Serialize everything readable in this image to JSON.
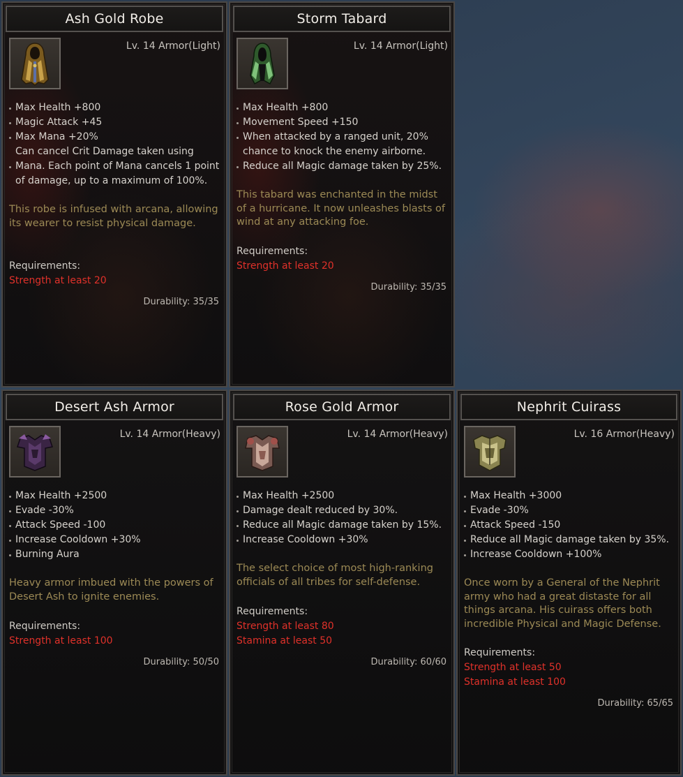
{
  "cards": [
    {
      "title": "Ash Gold Robe",
      "icon": "robe-icon",
      "level": "Lv. 14 Armor(Light)",
      "stats": [
        "Max Health +800",
        "Magic Attack +45",
        "Max Mana +20%",
        "Can cancel Crit Damage taken using",
        "Mana. Each point of Mana cancels 1 point",
        "of damage, up to a maximum of 100%."
      ],
      "flavor": "This robe is infused with arcana, allowing its wearer to resist physical damage.",
      "req_label": "Requirements:",
      "requirements": [
        "Strength at least 20"
      ],
      "durability": "Durability: 35/35"
    },
    {
      "title": "Storm Tabard",
      "icon": "tabard-icon",
      "level": "Lv. 14 Armor(Light)",
      "stats": [
        "Max Health +800",
        "Movement Speed +150",
        "When attacked by a ranged unit, 20%",
        "chance to knock the enemy airborne.",
        "Reduce all Magic damage taken by 25%."
      ],
      "flavor": "This tabard was enchanted in the midst of a hurricane. It now unleashes blasts of wind at any attacking foe.",
      "req_label": "Requirements:",
      "requirements": [
        "Strength at least 20"
      ],
      "durability": "Durability: 35/35"
    },
    {
      "title": "Desert Ash Armor",
      "icon": "heavy-armor-dark-icon",
      "level": "Lv. 14 Armor(Heavy)",
      "stats": [
        "Max Health +2500",
        "Evade -30%",
        "Attack Speed -100",
        "Increase Cooldown +30%",
        "Burning Aura"
      ],
      "flavor": "Heavy armor imbued with the powers of Desert Ash to ignite enemies.",
      "req_label": "Requirements:",
      "requirements": [
        "Strength at least 100"
      ],
      "durability": "Durability: 50/50"
    },
    {
      "title": "Rose Gold Armor",
      "icon": "heavy-armor-rose-icon",
      "level": "Lv. 14 Armor(Heavy)",
      "stats": [
        "Max Health +2500",
        "Damage dealt reduced by 30%.",
        "Reduce all Magic damage taken by 15%.",
        "Increase Cooldown +30%"
      ],
      "flavor": "The select choice of most high-ranking officials of all tribes for self-defense.",
      "req_label": "Requirements:",
      "requirements": [
        "Strength at least 80",
        "Stamina at least 50"
      ],
      "durability": "Durability: 60/60"
    },
    {
      "title": "Nephrit Cuirass",
      "icon": "cuirass-icon",
      "level": "Lv. 16 Armor(Heavy)",
      "stats": [
        "Max Health +3000",
        "Evade -30%",
        "Attack Speed -150",
        "Reduce all Magic damage taken by 35%.",
        "Increase Cooldown +100%"
      ],
      "flavor": "Once worn by a General of the Nephrit army who had a great distaste for all things arcana. His cuirass offers both incredible Physical and Magic Defense.",
      "req_label": "Requirements:",
      "requirements": [
        "Strength at least 50",
        "Stamina at least 100"
      ],
      "durability": "Durability: 65/65"
    }
  ]
}
